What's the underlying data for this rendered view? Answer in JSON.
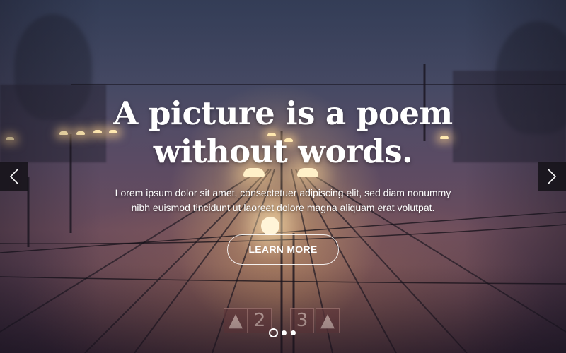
{
  "hero": {
    "headline_line1": "A picture is a poem",
    "headline_line2": "without words.",
    "lead_line1": "Lorem ipsum dolor sit amet, consectetuer adipiscing elit, sed diam nonummy",
    "lead_line2": "nibh euismod tincidunt ut laoreet dolore magna aliquam erat volutpat.",
    "cta_label": "LEARN MORE"
  },
  "background": {
    "platform_numbers": [
      "2",
      "3"
    ]
  },
  "slider": {
    "prev_icon": "chevron-left-icon",
    "next_icon": "chevron-right-icon",
    "slide_count": 3,
    "active_index": 0
  },
  "colors": {
    "text": "#ffffff",
    "arrow_bg": "#141218",
    "lamp_glow": "#ffe8b0"
  }
}
